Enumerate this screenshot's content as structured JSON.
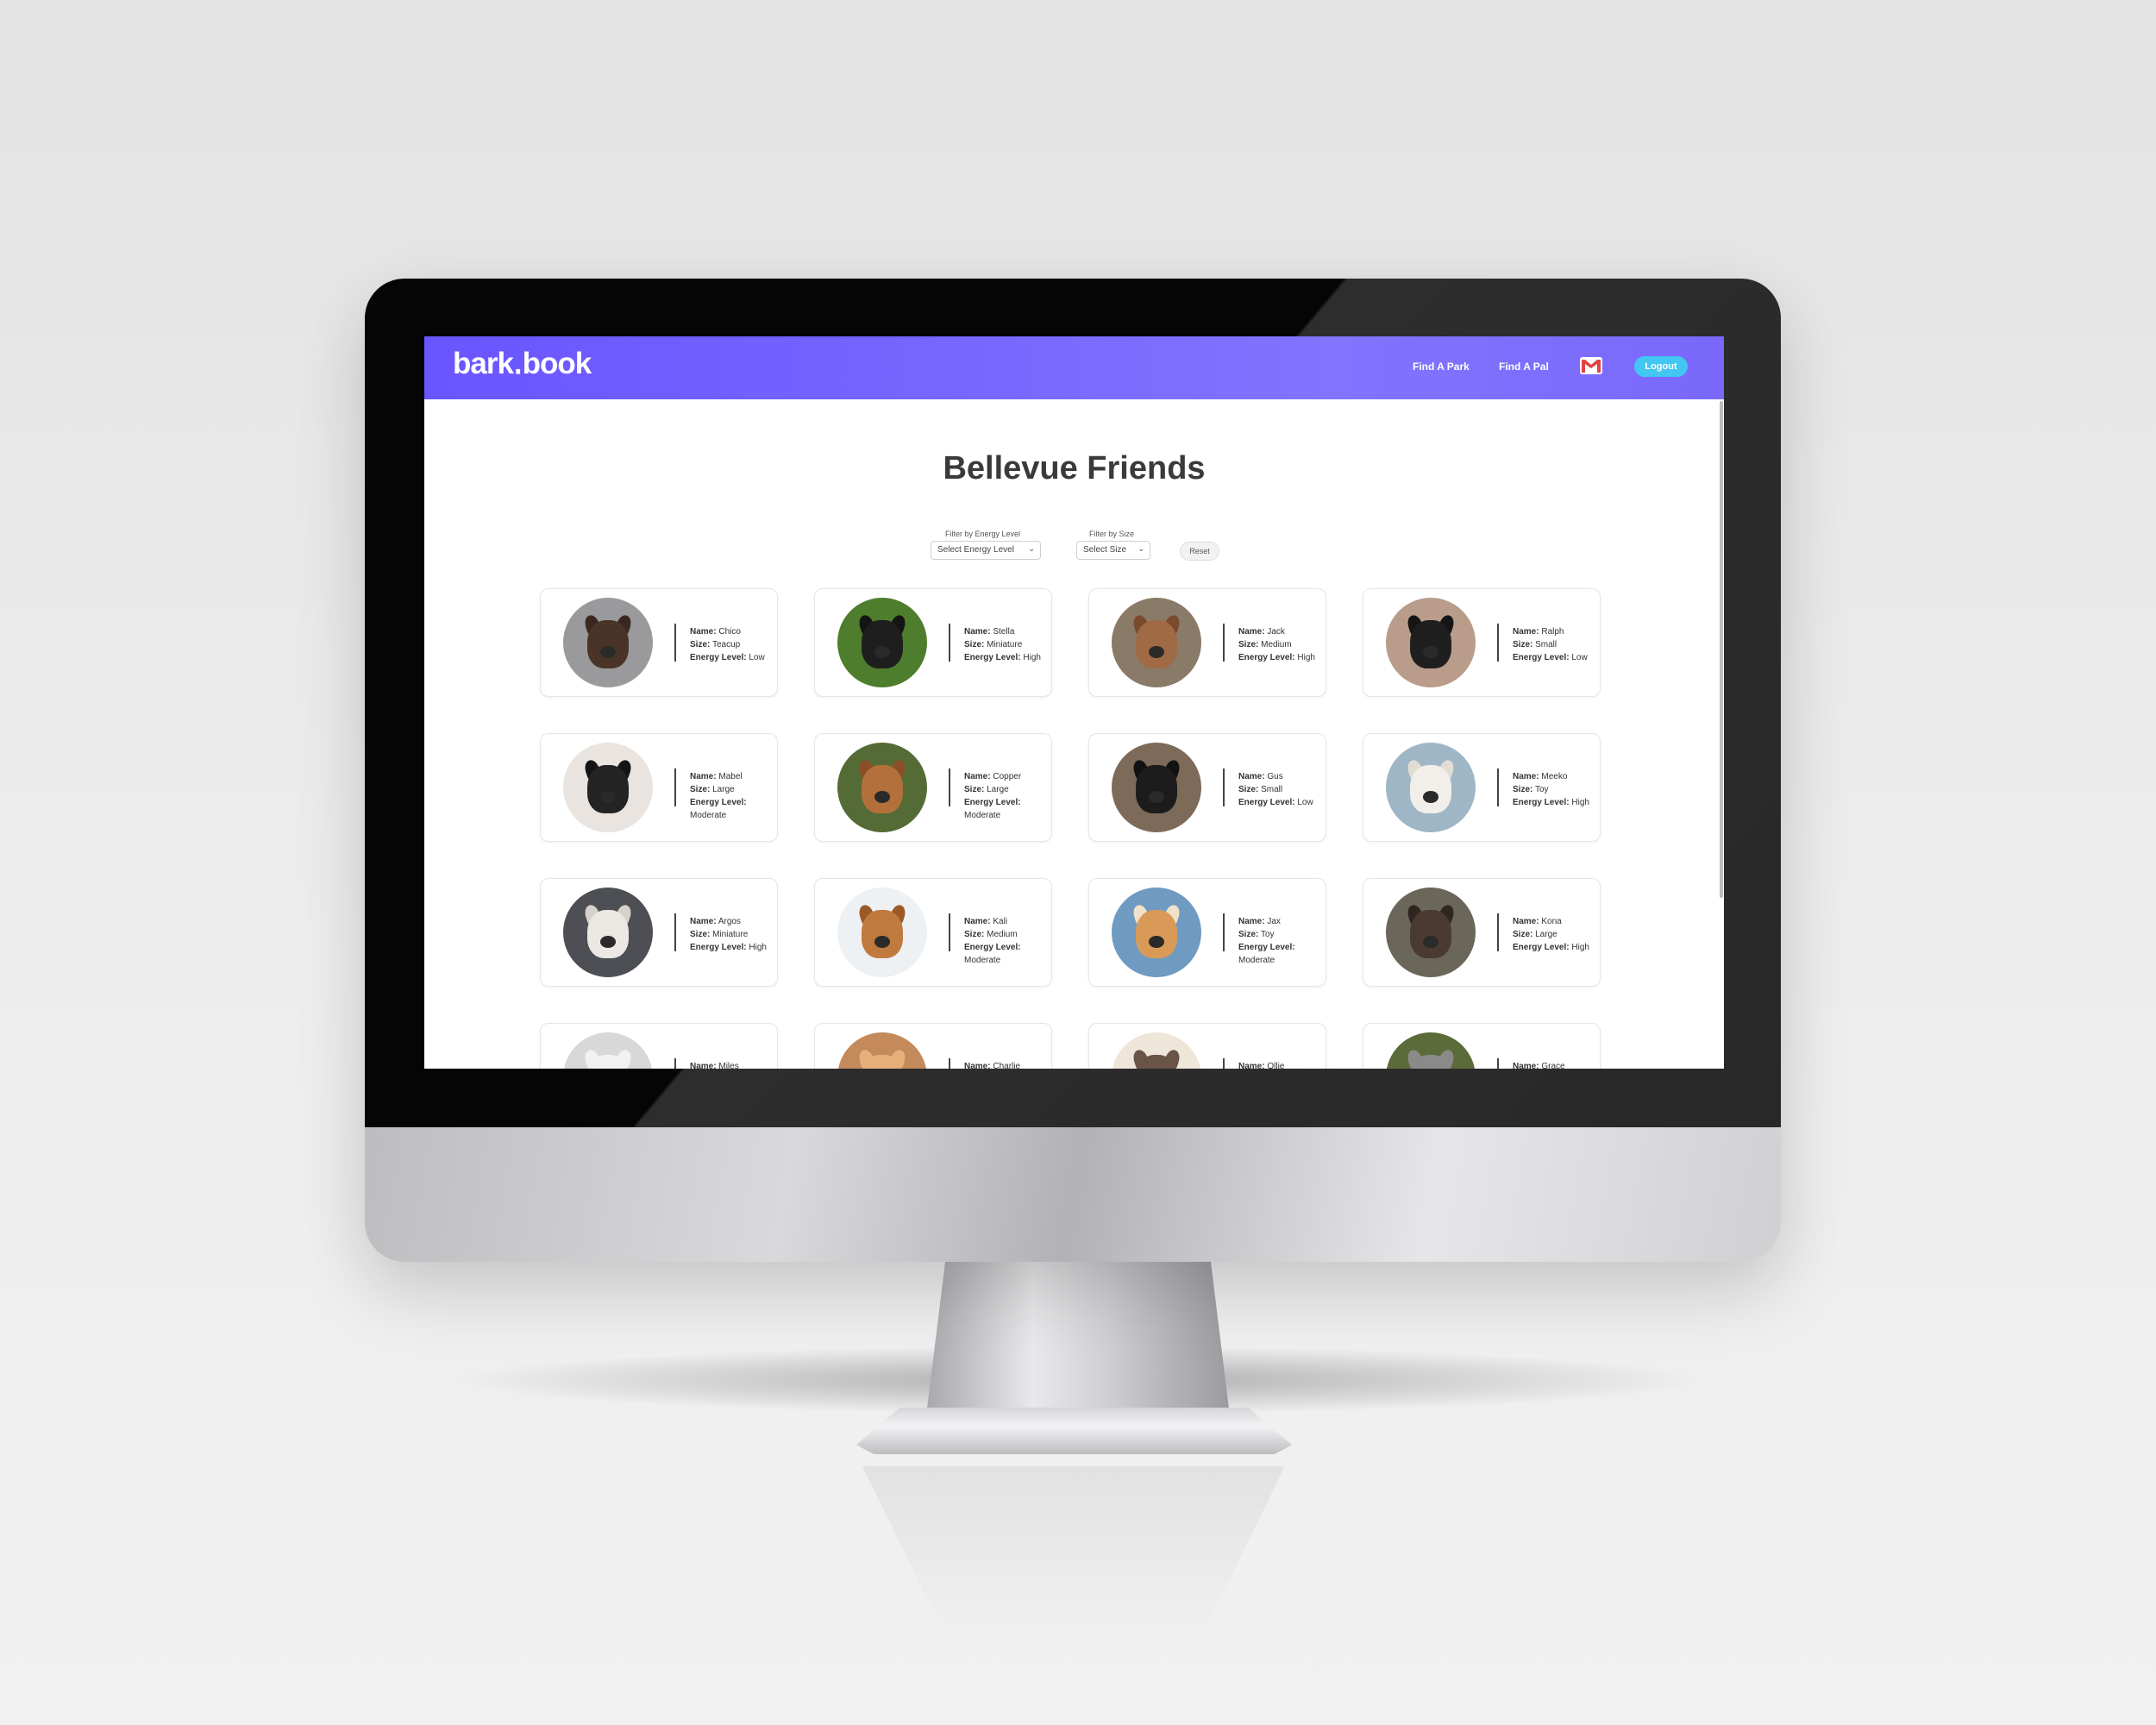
{
  "app": {
    "logo_text": "bark․book",
    "brand_colors": {
      "nav_start": "#6a55ff",
      "nav_end": "#8274ff",
      "accent": "#42c6f2"
    }
  },
  "nav": {
    "links": [
      "Find A Park",
      "Find A Pal"
    ],
    "mail_icon": "mail-icon",
    "logout_label": "Logout"
  },
  "page": {
    "title": "Bellevue Friends"
  },
  "filters": {
    "energy": {
      "label": "Filter by Energy Level",
      "value": "Select Energy Level"
    },
    "size": {
      "label": "Filter by Size",
      "value": "Select Size"
    },
    "reset_label": "Reset"
  },
  "labels": {
    "name": "Name:",
    "size": "Size:",
    "energy": "Energy Level:"
  },
  "dogs": [
    {
      "name": "Chico",
      "size": "Teacup",
      "energy": "Low",
      "bg": "#9a9a9c",
      "coat": "#4a3428",
      "ear": "#3a2820"
    },
    {
      "name": "Stella",
      "size": "Miniature",
      "energy": "High",
      "bg": "#4f7d2e",
      "coat": "#1e1e1e",
      "ear": "#141414"
    },
    {
      "name": "Jack",
      "size": "Medium",
      "energy": "High",
      "bg": "#8a7a68",
      "coat": "#a06a44",
      "ear": "#7a4a2c"
    },
    {
      "name": "Ralph",
      "size": "Small",
      "energy": "Low",
      "bg": "#b99d8a",
      "coat": "#1f1f1f",
      "ear": "#151515"
    },
    {
      "name": "Mabel",
      "size": "Large",
      "energy": "Moderate",
      "bg": "#e9e4df",
      "coat": "#232323",
      "ear": "#151515"
    },
    {
      "name": "Copper",
      "size": "Large",
      "energy": "Moderate",
      "bg": "#556b36",
      "coat": "#b4703a",
      "ear": "#8a4f26"
    },
    {
      "name": "Gus",
      "size": "Small",
      "energy": "Low",
      "bg": "#7d6a58",
      "coat": "#1c1c1c",
      "ear": "#121212"
    },
    {
      "name": "Meeko",
      "size": "Toy",
      "energy": "High",
      "bg": "#9fb6c6",
      "coat": "#f2efea",
      "ear": "#e2ddd4"
    },
    {
      "name": "Argos",
      "size": "Miniature",
      "energy": "High",
      "bg": "#4d4f54",
      "coat": "#ebe7e2",
      "ear": "#d6d1ca"
    },
    {
      "name": "Kali",
      "size": "Medium",
      "energy": "Moderate",
      "bg": "#eef1f4",
      "coat": "#c07a3e",
      "ear": "#9a5a28"
    },
    {
      "name": "Jax",
      "size": "Toy",
      "energy": "Moderate",
      "bg": "#6f9ac2",
      "coat": "#d99a58",
      "ear": "#f0e2c8"
    },
    {
      "name": "Kona",
      "size": "Large",
      "energy": "High",
      "bg": "#6b665a",
      "coat": "#4a3a30",
      "ear": "#302620"
    }
  ],
  "dogs_partial": [
    {
      "name": "Miles",
      "bg": "#d8d8d8",
      "coat": "#f2f2f2"
    },
    {
      "name": "Charlie",
      "bg": "#c48a5c",
      "coat": "#e6b07a"
    },
    {
      "name": "Ollie",
      "bg": "#efe6da",
      "coat": "#6a5446"
    },
    {
      "name": "Grace",
      "bg": "#5b6b3a",
      "coat": "#8a8a8a"
    }
  ]
}
